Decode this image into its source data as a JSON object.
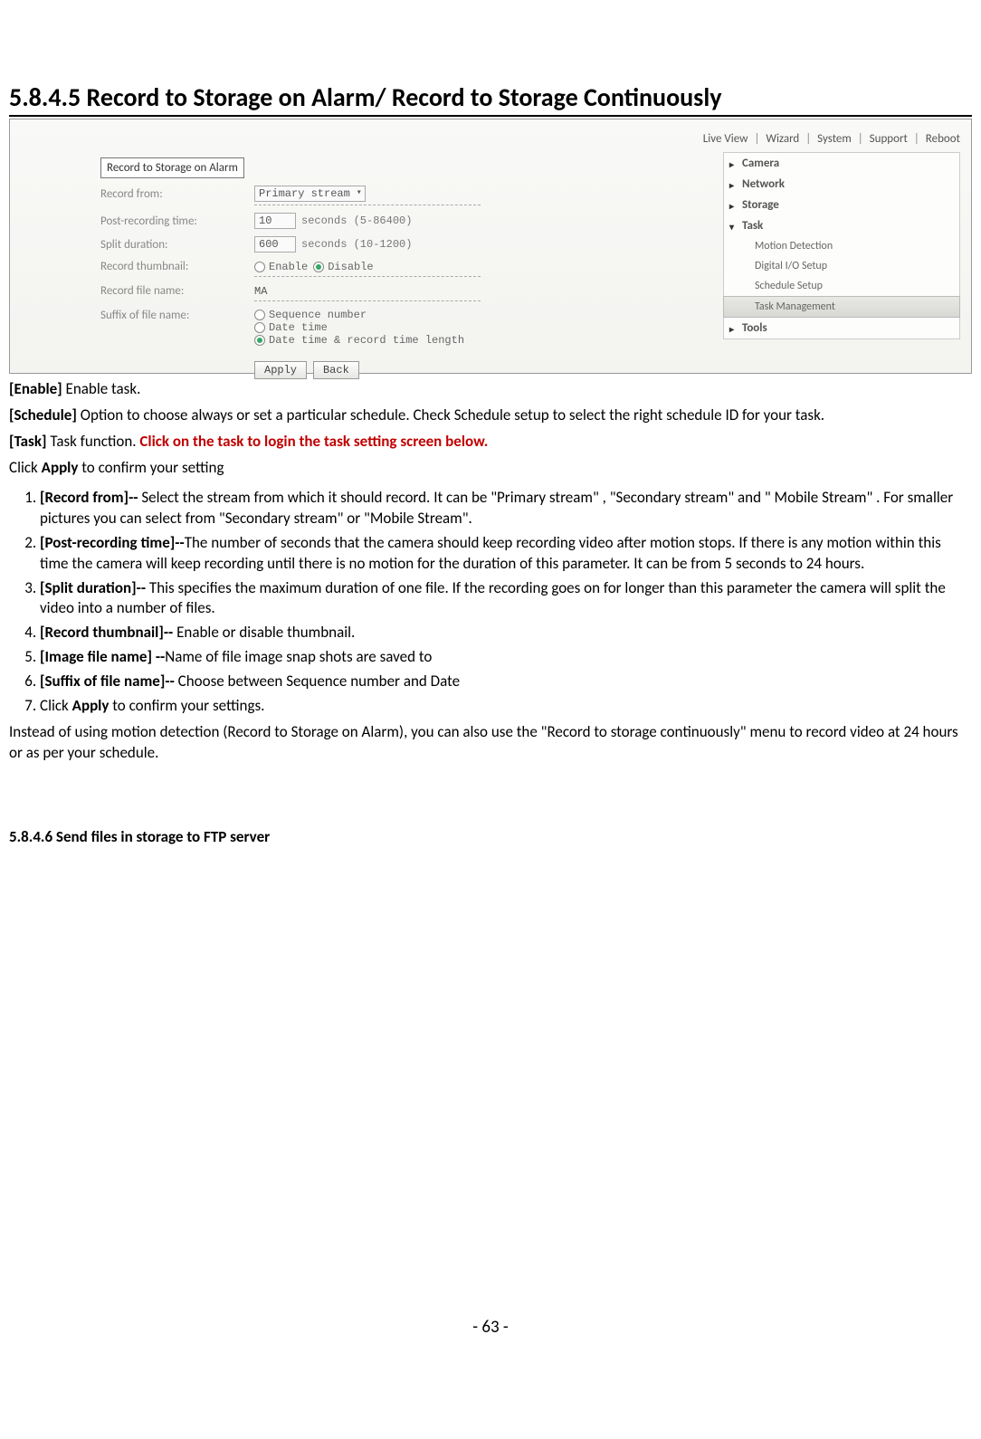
{
  "heading": "5.8.4.5 Record to Storage on Alarm/ Record to Storage Continuously",
  "topnav": [
    "Live View",
    "Wizard",
    "System",
    "Support",
    "Reboot"
  ],
  "sidebar": {
    "camera": "Camera",
    "network": "Network",
    "storage": "Storage",
    "task": "Task",
    "motion": "Motion Detection",
    "digital": "Digital I/O Setup",
    "schedule": "Schedule Setup",
    "taskmgmt": "Task Management",
    "tools": "Tools"
  },
  "form": {
    "title": "Record to Storage on Alarm",
    "record_from_label": "Record from:",
    "record_from_value": "Primary stream",
    "post_label": "Post-recording time:",
    "post_value": "10",
    "post_hint": "seconds (5-86400)",
    "split_label": "Split duration:",
    "split_value": "600",
    "split_hint": "seconds (10-1200)",
    "thumb_label": "Record thumbnail:",
    "thumb_enable": "Enable",
    "thumb_disable": "Disable",
    "fname_label": "Record file name:",
    "fname_value": "MA",
    "suffix_label": "Suffix of file name:",
    "suffix_seq": "Sequence number",
    "suffix_date": "Date time",
    "suffix_both": "Date time & record time length",
    "apply": "Apply",
    "back": "Back"
  },
  "para": {
    "enable": "[Enable]",
    "enable_text": " Enable task.",
    "schedule": "[Schedule]",
    "schedule_text": " Option to choose always or set a particular schedule. Check Schedule setup to select the right schedule ID for your task.",
    "task": "[Task]",
    "task_text": " Task function. ",
    "task_red": "Click on the task to login the task setting screen below.",
    "click_apply_pre": "Click ",
    "click_apply_bold": "Apply",
    "click_apply_post": " to confirm your setting"
  },
  "list": {
    "i1_b": "[Record from]--",
    "i1_t": " Select the stream from which it should record. It can be \"Primary stream\" , \"Secondary stream\" and \" Mobile Stream\" . For smaller pictures you can select from \"Secondary stream\" or \"Mobile Stream\".",
    "i2_b": "[Post-recording time]--",
    "i2_t": "The number of seconds that the camera should keep recording video after motion stops. If there is any motion within this time the camera will keep recording until there is no motion for the duration of this parameter. It can be from 5 seconds to 24 hours.",
    "i3_b": "[Split duration]--",
    "i3_t": " This specifies the maximum duration of one file. If the recording goes on for longer than this parameter the camera will split the video into a number of files.",
    "i4_b": "[Record thumbnail]--",
    "i4_t": " Enable or disable thumbnail.",
    "i5_b": "[Image file name] --",
    "i5_t": "Name of file image snap shots are saved to",
    "i6_b": "[Suffix of file name]--",
    "i6_t": " Choose between Sequence number and Date",
    "i7_pre": "Click ",
    "i7_bold": "Apply",
    "i7_post": " to confirm your settings."
  },
  "closing": "Instead of using motion detection (Record to Storage on Alarm), you can also use the \"Record to storage continuously\" menu to record video at 24 hours or as per your schedule.",
  "subheading": "5.8.4.6 Send files in storage to FTP server",
  "pagenum": "- 63 -"
}
